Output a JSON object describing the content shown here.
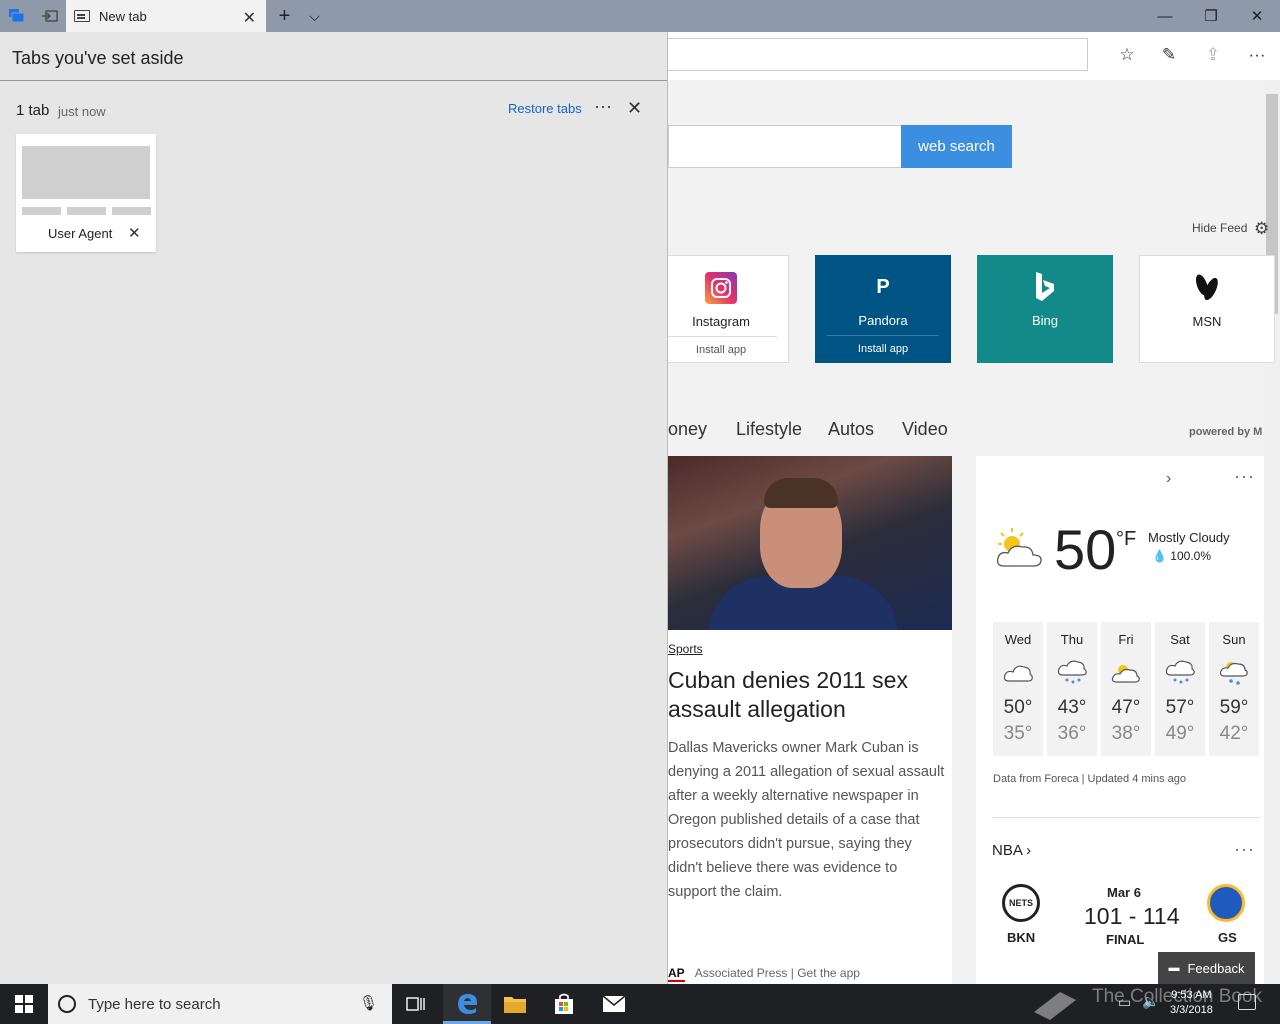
{
  "browser": {
    "active_tab_title": "New tab",
    "new_tab_plus": "+",
    "tab_list_chevron": "⌵",
    "close_glyph": "✕",
    "minimize_glyph": "—",
    "restore_glyph": "❐",
    "toolbar": {
      "favorites_glyph": "☆",
      "notes_glyph": "✎",
      "share_glyph": "⇪",
      "more_glyph": "···"
    }
  },
  "aside": {
    "title": "Tabs you've set aside",
    "group": {
      "count": "1 tab",
      "time": "just now",
      "restore_label": "Restore tabs",
      "more_glyph": "···",
      "close_glyph": "✕"
    },
    "thumbnail": {
      "label": "User Agent",
      "close_glyph": "✕"
    }
  },
  "page": {
    "search_button": "web search",
    "hide_feed": "Hide Feed",
    "gear_glyph": "⚙",
    "tiles": [
      {
        "name": "Instagram",
        "install": "Install app",
        "bg": "#ffffff",
        "fg": "#222222"
      },
      {
        "name": "Pandora",
        "install": "Install app",
        "bg": "#005483",
        "fg": "#ffffff",
        "logo": "P"
      },
      {
        "name": "Bing",
        "bg": "#138a8a",
        "fg": "#ffffff"
      },
      {
        "name": "MSN",
        "bg": "#ffffff",
        "fg": "#222222"
      }
    ],
    "nav": [
      "oney",
      "Lifestyle",
      "Autos",
      "Video"
    ],
    "powered_by": "powered by M",
    "news": {
      "category": "Sports",
      "title": "Cuban denies 2011 sex assault allegation",
      "body": "Dallas Mavericks owner Mark Cuban is denying a 2011 allegation of sexual assault after a weekly alternative newspaper in Oregon published details of a case that prosecutors didn't pursue, saying they didn't believe there was evidence to support the claim.",
      "source_badge": "AP",
      "source": "Associated Press",
      "get_app": "| Get the app"
    },
    "weather": {
      "chevron": "›",
      "more": "···",
      "temp": "50",
      "unit": "°F",
      "condition": "Mostly Cloudy",
      "precip": "100.0%",
      "days": [
        {
          "name": "Wed",
          "hi": "50°",
          "lo": "35°"
        },
        {
          "name": "Thu",
          "hi": "43°",
          "lo": "36°"
        },
        {
          "name": "Fri",
          "hi": "47°",
          "lo": "38°"
        },
        {
          "name": "Sat",
          "hi": "57°",
          "lo": "49°"
        },
        {
          "name": "Sun",
          "hi": "59°",
          "lo": "42°"
        }
      ],
      "source": "Data from Foreca | Updated 4 mins ago"
    },
    "nba": {
      "label": "NBA ›",
      "more": "···",
      "date": "Mar 6",
      "score": "101 - 114",
      "status": "FINAL",
      "home": "BKN",
      "home_logo": "NETS",
      "away": "GS"
    },
    "feedback": "Feedback"
  },
  "taskbar": {
    "search_placeholder": "Type here to search",
    "mic_glyph": "🎙",
    "time": "9:53 AM",
    "date": "3/3/2018",
    "watermark": "The Collection Book"
  }
}
